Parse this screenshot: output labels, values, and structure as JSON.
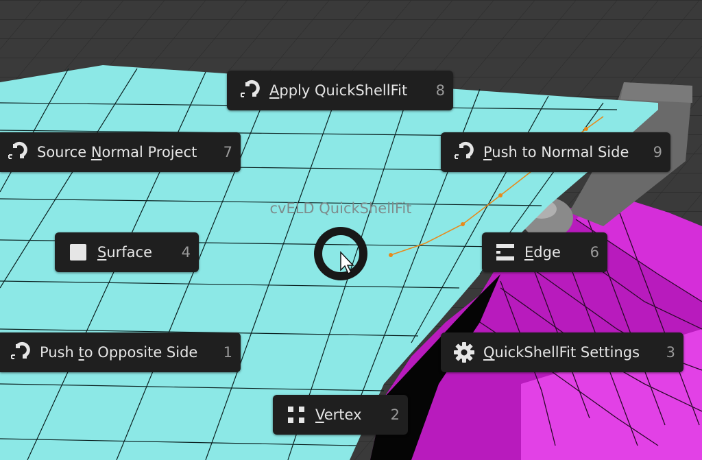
{
  "pie_menu": {
    "title": "cvELD QuickShellFit",
    "items": [
      {
        "id": "apply",
        "pre": "",
        "u": "A",
        "post": "pply QuickShellFit",
        "hotkey": "8",
        "icon": "magnet-icon"
      },
      {
        "id": "source-normal",
        "pre": "Source ",
        "u": "N",
        "post": "ormal Project",
        "hotkey": "7",
        "icon": "magnet-icon"
      },
      {
        "id": "push-normal",
        "pre": "",
        "u": "P",
        "post": "ush to Normal Side",
        "hotkey": "9",
        "icon": "magnet-icon"
      },
      {
        "id": "surface",
        "pre": "",
        "u": "S",
        "post": "urface",
        "hotkey": "4",
        "icon": "square-icon"
      },
      {
        "id": "edge",
        "pre": "",
        "u": "E",
        "post": "dge",
        "hotkey": "6",
        "icon": "edge-select-icon"
      },
      {
        "id": "push-opposite",
        "pre": "Push ",
        "u": "t",
        "post": "o Opposite Side",
        "hotkey": "1",
        "icon": "magnet-icon"
      },
      {
        "id": "settings",
        "pre": "",
        "u": "Q",
        "post": "uickShellFit Settings",
        "hotkey": "3",
        "icon": "gear-icon"
      },
      {
        "id": "vertex",
        "pre": "",
        "u": "V",
        "post": "ertex",
        "hotkey": "2",
        "icon": "vertex-select-icon"
      }
    ]
  },
  "colors": {
    "background": "#3a3a3a",
    "plane": "#8ce8e6",
    "object": "#c21cc6",
    "menu_bg": "#1f1f1f",
    "menu_text": "#e6e6e6",
    "hotkey_text": "#9a9a9a",
    "selected_edge": "#e8891a"
  }
}
